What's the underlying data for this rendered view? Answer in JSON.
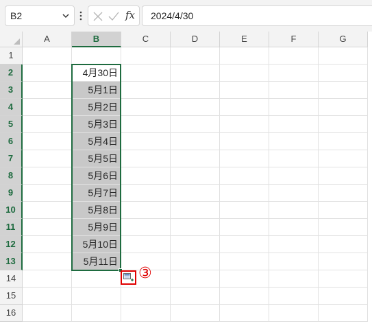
{
  "namebox": {
    "value": "B2"
  },
  "formula": {
    "value": "2024/4/30",
    "fx_label": "fx"
  },
  "columns": [
    "A",
    "B",
    "C",
    "D",
    "E",
    "F",
    "G"
  ],
  "rows": [
    "1",
    "2",
    "3",
    "4",
    "5",
    "6",
    "7",
    "8",
    "9",
    "10",
    "11",
    "12",
    "13",
    "14",
    "15",
    "16"
  ],
  "selected_column": "B",
  "b_values": [
    "4月30日",
    "5月1日",
    "5月2日",
    "5月3日",
    "5月4日",
    "5月5日",
    "5月6日",
    "5月7日",
    "5月8日",
    "5月9日",
    "5月10日",
    "5月11日"
  ],
  "annotation": {
    "label": "③"
  },
  "colors": {
    "accent": "#1e6b3f",
    "highlight_fill": "#c8c8c8",
    "annotation_red": "#e00000"
  }
}
